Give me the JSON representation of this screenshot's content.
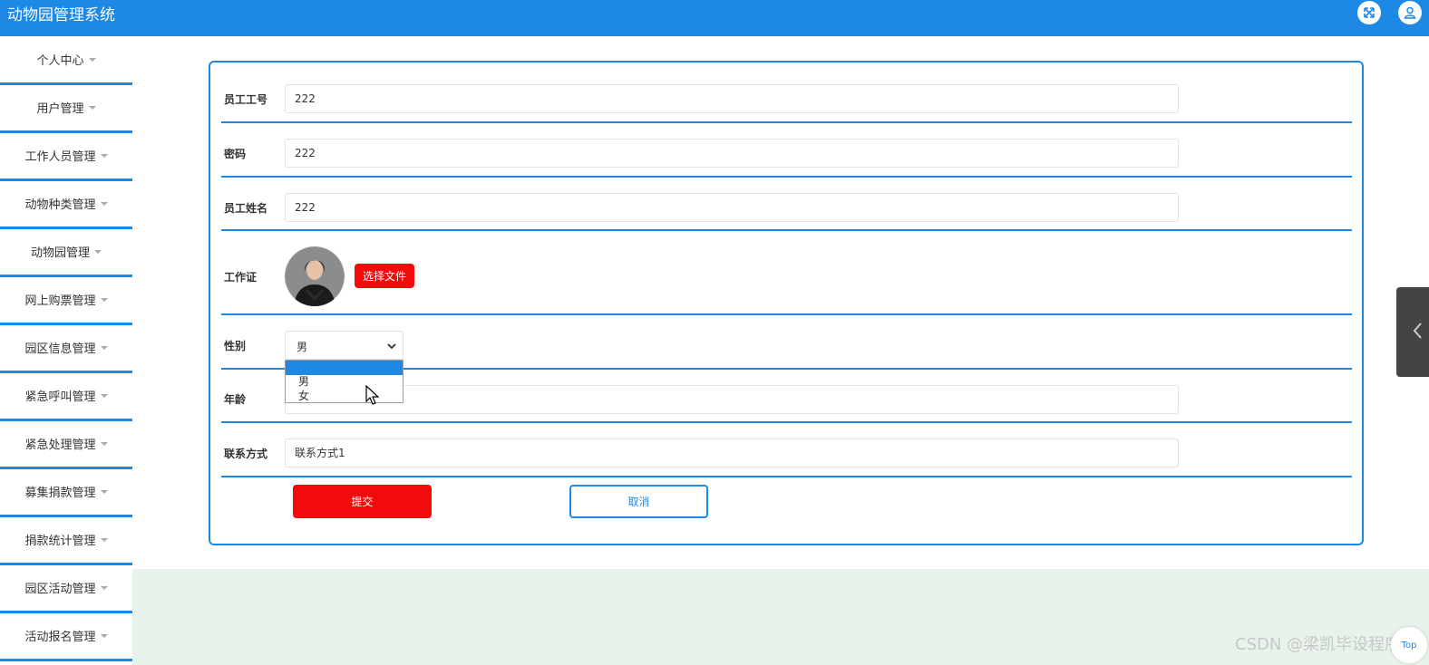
{
  "app": {
    "title": "动物园管理系统",
    "brand_color": "#1e88e5",
    "danger_color": "#f20b0b"
  },
  "header": {
    "icons": [
      "fullscreen-icon",
      "user-icon"
    ]
  },
  "sidebar": {
    "items": [
      {
        "label": "个人中心"
      },
      {
        "label": "用户管理"
      },
      {
        "label": "工作人员管理"
      },
      {
        "label": "动物种类管理"
      },
      {
        "label": "动物园管理"
      },
      {
        "label": "网上购票管理"
      },
      {
        "label": "园区信息管理"
      },
      {
        "label": "紧急呼叫管理"
      },
      {
        "label": "紧急处理管理"
      },
      {
        "label": "募集捐款管理"
      },
      {
        "label": "捐款统计管理"
      },
      {
        "label": "园区活动管理"
      },
      {
        "label": "活动报名管理"
      }
    ]
  },
  "form": {
    "staff_no": {
      "label": "员工工号",
      "value": "222"
    },
    "password": {
      "label": "密码",
      "value": "222"
    },
    "staff_name": {
      "label": "员工姓名",
      "value": "222"
    },
    "work_card": {
      "label": "工作证",
      "button": "选择文件"
    },
    "gender": {
      "label": "性别",
      "value": "男",
      "options": [
        "",
        "男",
        "女"
      ]
    },
    "age": {
      "label": "年龄",
      "value": ""
    },
    "contact": {
      "label": "联系方式",
      "value": "联系方式1"
    },
    "submit_label": "提交",
    "cancel_label": "取消"
  },
  "watermark": "CSDN @梁凯毕设程序",
  "back_to_top": "Top"
}
